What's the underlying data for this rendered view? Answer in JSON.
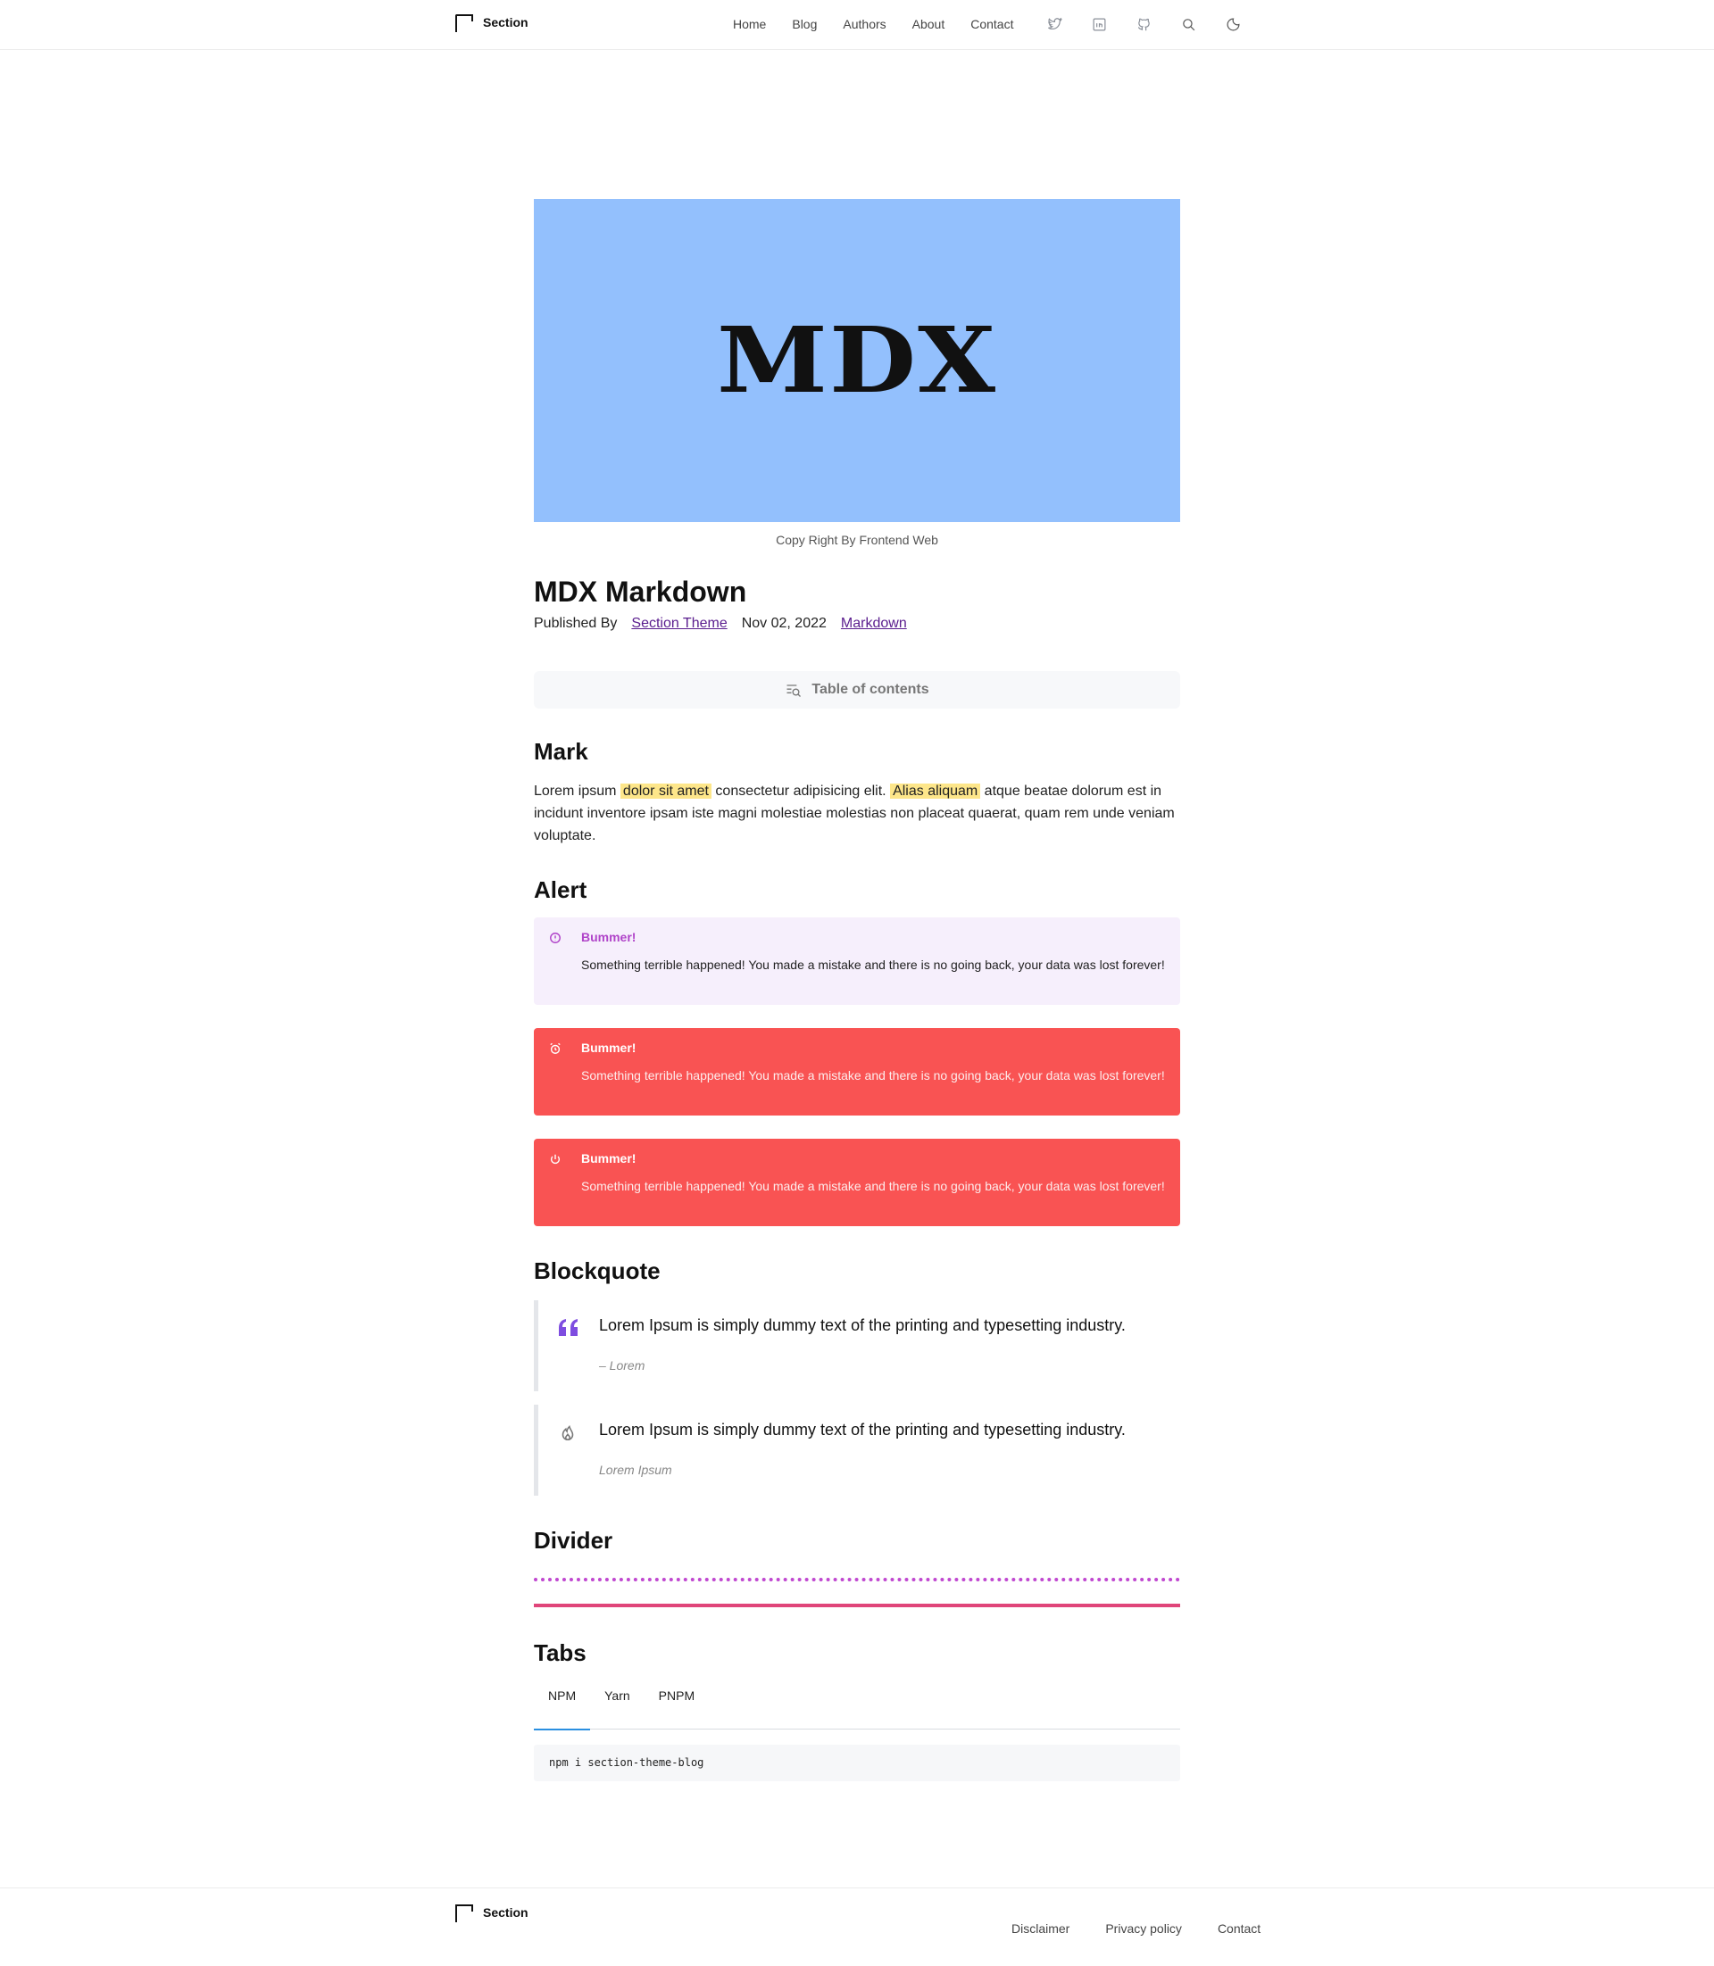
{
  "header": {
    "brand": "Section",
    "nav": [
      "Home",
      "Blog",
      "Authors",
      "About",
      "Contact"
    ],
    "icons": [
      "twitter-icon",
      "linkedin-icon",
      "github-icon",
      "search-icon",
      "moon-icon"
    ]
  },
  "hero": {
    "image_text": "MDX",
    "background": "#93c0fd",
    "caption": "Copy Right By Frontend Web"
  },
  "post": {
    "title": "MDX Markdown",
    "published_by": "Published By",
    "author": "Section Theme",
    "date": "Nov 02, 2022",
    "category": "Markdown"
  },
  "toc": {
    "label": "Table of contents"
  },
  "sections": {
    "mark": "Mark",
    "alert": "Alert",
    "blockquote": "Blockquote",
    "divider": "Divider",
    "tabs": "Tabs"
  },
  "mark_para": {
    "p1": "Lorem ipsum ",
    "h1": "dolor sit amet",
    "p2": " consectetur adipisicing elit. ",
    "h2": "Alias aliquam",
    "p3": " atque beatae dolorum est in incidunt inventore ipsam iste magni molestiae molestias non placeat quaerat, quam rem unde veniam voluptate."
  },
  "alerts": [
    {
      "title": "Bummer!",
      "body": "Something terrible happened! You made a mistake and there is no going back, your data was lost forever!",
      "icon": "info-circle-icon",
      "color": "#f6effc"
    },
    {
      "title": "Bummer!",
      "body": "Something terrible happened! You made a mistake and there is no going back, your data was lost forever!",
      "icon": "alarm-icon",
      "color": "#f95353"
    },
    {
      "title": "Bummer!",
      "body": "Something terrible happened! You made a mistake and there is no going back, your data was lost forever!",
      "icon": "power-icon",
      "color": "#f95353"
    }
  ],
  "quotes": [
    {
      "text": "Lorem Ipsum is simply dummy text of the printing and typesetting industry.",
      "author": "– Lorem",
      "icon": "quote-icon"
    },
    {
      "text": "Lorem Ipsum is simply dummy text of the printing and typesetting industry.",
      "author": "Lorem Ipsum",
      "icon": "flame-icon"
    }
  ],
  "divider_colors": {
    "dotted": "#c048d0",
    "solid": "#e0457a"
  },
  "tabs": {
    "items": [
      "NPM",
      "Yarn",
      "PNPM"
    ],
    "active": "NPM",
    "code": "npm i section-theme-blog"
  },
  "footer": {
    "brand": "Section",
    "links": [
      "Disclaimer",
      "Privacy policy",
      "Contact"
    ]
  }
}
